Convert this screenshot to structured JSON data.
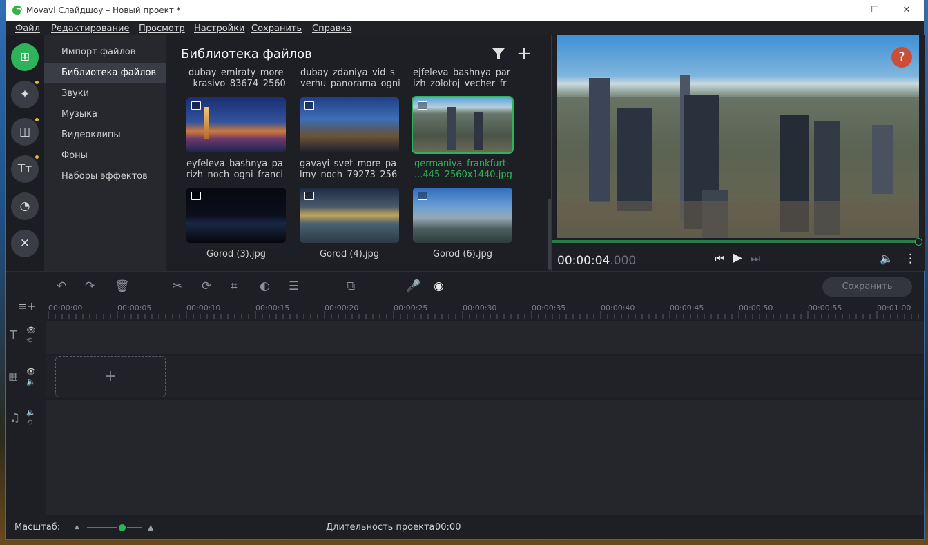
{
  "window": {
    "title": "Movavi Слайдшоу – Новый проект *",
    "minimize": "—",
    "maximize": "☐",
    "close": "✕"
  },
  "menu": [
    "Файл",
    "Редактирование",
    "Просмотр",
    "Настройки",
    "Сохранить",
    "Справка"
  ],
  "rail": {
    "buttons": [
      {
        "icon": "import-icon",
        "glyph": "⊞",
        "active": true,
        "dot": false
      },
      {
        "icon": "magic-wand-icon",
        "glyph": "✦",
        "active": false,
        "dot": true
      },
      {
        "icon": "transitions-icon",
        "glyph": "◫",
        "active": false,
        "dot": true
      },
      {
        "icon": "titles-icon",
        "glyph": "Tт",
        "active": false,
        "dot": true
      },
      {
        "icon": "filters-icon",
        "glyph": "◔",
        "active": false,
        "dot": false
      },
      {
        "icon": "tools-icon",
        "glyph": "✕",
        "active": false,
        "dot": false
      }
    ]
  },
  "sidebar": {
    "items": [
      "Импорт файлов",
      "Библиотека файлов",
      "Звуки",
      "Музыка",
      "Видеоклипы",
      "Фоны",
      "Наборы эффектов"
    ],
    "active_index": 1
  },
  "library": {
    "title": "Библиотека файлов",
    "top_captions": [
      [
        "dubay_emiraty_more",
        "_krasivo_83674_2560"
      ],
      [
        "dubay_zdaniya_vid_s",
        "verhu_panorama_ogni"
      ],
      [
        "ejfeleva_bashnya_par",
        "izh_zolotoj_vecher_fr"
      ]
    ],
    "row1": [
      {
        "caption": [
          "eyfeleva_bashnya_pa",
          "rizh_noch_ogni_franci"
        ],
        "selected": false
      },
      {
        "caption": [
          "gavayi_svet_more_pa",
          "lmy_noch_79273_256"
        ],
        "selected": false
      },
      {
        "caption": [
          "germaniya_frankfurt-",
          "...445_2560x1440.jpg"
        ],
        "selected": true
      }
    ],
    "row2": [
      {
        "caption": "Gorod  (3).jpg"
      },
      {
        "caption": "Gorod  (4).jpg"
      },
      {
        "caption": "Gorod  (6).jpg"
      }
    ]
  },
  "preview": {
    "help": "?",
    "time_main": "00:00:04",
    "time_ms": ".000",
    "progress": 1.0
  },
  "toolbar": {
    "save_label": "Сохранить"
  },
  "ruler": [
    "00:00:00",
    "00:00:05",
    "00:00:10",
    "00:00:15",
    "00:00:20",
    "00:00:25",
    "00:00:30",
    "00:00:35",
    "00:00:40",
    "00:00:45",
    "00:00:50",
    "00:00:55",
    "00:01:00"
  ],
  "dropzone": {
    "glyph": "+"
  },
  "status": {
    "scale_label": "Масштаб:",
    "duration_label": "Длительность проекта:",
    "duration_value": "00:00",
    "zoom_level": 0.55
  },
  "colors": {
    "accent": "#2db35a",
    "help": "#c8503b",
    "dot": "#e6c325"
  }
}
